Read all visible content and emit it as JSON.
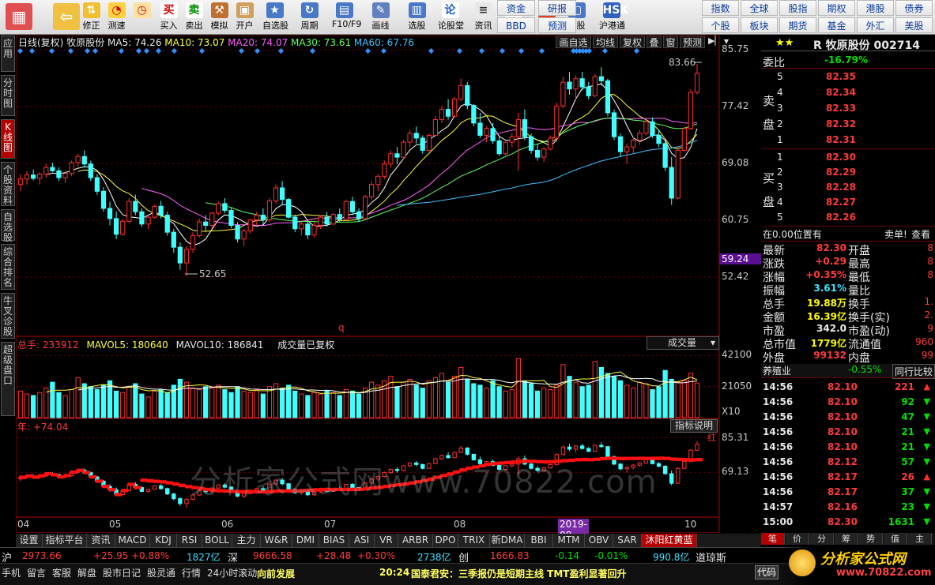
{
  "toolbar": {
    "left_buttons": [
      {
        "label": "",
        "icon": "grid-icon"
      },
      {
        "label": "",
        "icon": "back-arrow-icon"
      },
      {
        "label": "修正",
        "icon": "arrows-icon"
      },
      {
        "label": "测速",
        "icon": "speed-icon"
      },
      {
        "label": "",
        "icon": "clock-icon"
      },
      {
        "label": "买入",
        "icon": "buy-icon",
        "glyph": "买"
      },
      {
        "label": "卖出",
        "icon": "sell-icon",
        "glyph": "卖"
      },
      {
        "label": "模拟",
        "icon": "hammer-icon"
      },
      {
        "label": "开户",
        "icon": "lock-icon"
      },
      {
        "label": "自选股",
        "icon": "star-box-icon"
      },
      {
        "label": "周期",
        "icon": "cycle-icon"
      },
      {
        "label": "F10/F9",
        "icon": "f10-icon"
      },
      {
        "label": "画线",
        "icon": "pen-icon"
      },
      {
        "label": "选股",
        "icon": "chart-select-icon"
      },
      {
        "label": "论股堂",
        "icon": "forum-icon",
        "glyph": "论"
      },
      {
        "label": "资讯",
        "icon": "news-icon"
      },
      {
        "label": "数据",
        "icon": "pe-icon",
        "glyph": "PE"
      },
      {
        "label": "热点",
        "icon": "hot-icon",
        "glyph": "HOT"
      },
      {
        "label": "新股",
        "icon": "newstock-icon"
      },
      {
        "label": "沪港通",
        "icon": "hk-connect-icon",
        "glyph": "HSK"
      }
    ],
    "grid_a": [
      "资金",
      "研报",
      "BBD",
      "预测"
    ],
    "grid_b": [
      "指数",
      "全球",
      "股指",
      "期权",
      "港股",
      "债券",
      "个股",
      "板块",
      "期货",
      "基金",
      "外汇",
      "美股"
    ]
  },
  "lefttabs": [
    "应用",
    "分时图",
    "K线图",
    "个股资料",
    "自选股",
    "综合排名",
    "牛叉诊股",
    "超级盘口"
  ],
  "chart_header": {
    "title": "日线(复权)",
    "stock": "牧原股份",
    "ma5": "MA5: 74.26",
    "ma10": "MA10: 73.07",
    "ma20": "MA20: 74.07",
    "ma30": "MA30: 73.61",
    "ma60": "MA60: 67.76"
  },
  "chart_tools": [
    "画自选",
    "均线",
    "复权",
    "叠",
    "窗",
    "预测"
  ],
  "chart_data": [
    {
      "type": "candlestick",
      "title": "日线(复权)",
      "y_ticks": [
        85.75,
        77.42,
        69.08,
        60.75,
        52.42
      ],
      "current_price_tag": "59.24",
      "annotations": [
        "83.66",
        "52.65"
      ],
      "month_labels": [
        "04",
        "05",
        "06",
        "07",
        "08",
        "10"
      ],
      "highlight_date": "2019-08-28,三",
      "candles": [
        [
          66,
          67.5,
          65,
          66.8
        ],
        [
          66.8,
          68,
          66,
          67.4
        ],
        [
          67.4,
          68.2,
          66.6,
          66.9
        ],
        [
          66.9,
          67.8,
          66,
          67.5
        ],
        [
          67.5,
          69,
          67,
          68.5
        ],
        [
          68.5,
          69.2,
          67.8,
          68
        ],
        [
          68,
          68.5,
          66.5,
          67
        ],
        [
          67,
          68,
          66.2,
          67.6
        ],
        [
          67.6,
          69.5,
          67.2,
          69.2
        ],
        [
          69.2,
          70.5,
          68.6,
          70.1
        ],
        [
          70.1,
          71,
          68.5,
          69
        ],
        [
          69,
          69.5,
          66.5,
          67
        ],
        [
          67,
          67.5,
          64.5,
          65
        ],
        [
          65,
          65.6,
          62,
          62.5
        ],
        [
          62.5,
          63.5,
          60,
          61
        ],
        [
          61,
          62,
          58,
          58.7
        ],
        [
          58.7,
          61,
          58.5,
          60.6
        ],
        [
          60.6,
          64,
          60.3,
          63.5
        ],
        [
          63.5,
          64.5,
          61.5,
          62
        ],
        [
          62,
          62.5,
          59.8,
          60.2
        ],
        [
          60.2,
          61.5,
          59.5,
          61.2
        ],
        [
          61.2,
          63,
          61,
          62.8
        ],
        [
          62.8,
          63.6,
          61,
          61.5
        ],
        [
          61.5,
          62,
          58.5,
          59
        ],
        [
          59,
          59.5,
          56,
          56.8
        ],
        [
          56.8,
          57.5,
          53.5,
          54.5
        ],
        [
          54.5,
          57,
          52.6,
          56.5
        ],
        [
          56.5,
          59,
          56,
          58.5
        ],
        [
          58.5,
          61,
          58.2,
          60.5
        ],
        [
          60.5,
          61.5,
          59.2,
          60
        ],
        [
          60,
          62,
          59.6,
          61.8
        ],
        [
          61.8,
          63.5,
          61.5,
          63.2
        ],
        [
          63.2,
          64,
          61.8,
          62.2
        ],
        [
          62.2,
          62.6,
          59.6,
          60
        ],
        [
          60,
          60.5,
          57.5,
          58
        ],
        [
          58,
          59.5,
          57,
          59.2
        ],
        [
          59.2,
          61,
          58.8,
          60.8
        ],
        [
          60.8,
          62,
          60,
          61.5
        ],
        [
          61.5,
          62.5,
          60.2,
          60.8
        ],
        [
          60.8,
          64,
          60.5,
          63.6
        ],
        [
          63.6,
          66,
          63.2,
          65.5
        ],
        [
          65.5,
          66.5,
          63,
          63.8
        ],
        [
          63.8,
          64,
          61,
          61.2
        ],
        [
          61.2,
          61.6,
          59,
          59.5
        ],
        [
          59.5,
          60.5,
          58.5,
          60.2
        ],
        [
          60.2,
          60.6,
          58,
          58.6
        ],
        [
          58.6,
          60.5,
          58.2,
          60
        ],
        [
          60,
          61.5,
          59.5,
          61.2
        ],
        [
          61.2,
          62,
          59.8,
          60.2
        ],
        [
          60.2,
          61.8,
          60,
          61.6
        ],
        [
          61.6,
          62.5,
          60.5,
          60.9
        ],
        [
          60.9,
          63.8,
          60.6,
          63.5
        ],
        [
          63.5,
          64.2,
          61.5,
          62
        ],
        [
          62,
          62.5,
          60.5,
          61
        ],
        [
          61,
          64.5,
          60.8,
          64.2
        ],
        [
          64.2,
          66.5,
          63.8,
          66
        ],
        [
          66,
          67.5,
          65,
          67.2
        ],
        [
          67.2,
          69.5,
          66.8,
          69
        ],
        [
          69,
          71,
          68.5,
          70.5
        ],
        [
          70.5,
          71.5,
          69,
          70
        ],
        [
          70,
          72.5,
          69.6,
          72.2
        ],
        [
          72.2,
          74,
          71.5,
          73.5
        ],
        [
          73.5,
          74.5,
          72,
          72.8
        ],
        [
          72.8,
          73.2,
          70.5,
          71
        ],
        [
          71,
          73.5,
          70.8,
          73.2
        ],
        [
          73.2,
          76,
          73,
          75.5
        ],
        [
          75.5,
          77.5,
          75,
          77
        ],
        [
          77,
          78.5,
          75.5,
          76
        ],
        [
          76,
          78.8,
          75.8,
          78.5
        ],
        [
          78.5,
          81.5,
          78.2,
          80.5
        ],
        [
          80.5,
          81,
          77,
          77.6
        ],
        [
          77.6,
          77.8,
          74.5,
          75
        ],
        [
          75,
          76.5,
          72.8,
          73.2
        ],
        [
          73.2,
          74.5,
          72.2,
          74.2
        ],
        [
          74.2,
          75,
          72,
          72.4
        ],
        [
          72.4,
          73,
          70.2,
          70.5
        ],
        [
          70.5,
          72.5,
          70,
          72.2
        ],
        [
          72.2,
          73.5,
          71.5,
          73
        ],
        [
          73,
          76.5,
          68,
          75.5
        ],
        [
          75.5,
          77,
          72.5,
          73
        ],
        [
          73,
          73.5,
          70.5,
          71
        ],
        [
          71,
          72,
          69.5,
          70
        ],
        [
          70,
          71.5,
          69.3,
          71.2
        ],
        [
          71.2,
          73.2,
          71,
          72.8
        ],
        [
          72.8,
          78,
          72.5,
          77.5
        ],
        [
          77.5,
          81.8,
          77.2,
          81
        ],
        [
          81,
          82.5,
          79.2,
          80
        ],
        [
          80,
          82,
          78.5,
          81.5
        ],
        [
          81.5,
          82.5,
          79.8,
          80.3
        ],
        [
          80.3,
          81,
          78.5,
          79
        ],
        [
          79,
          82.2,
          78.8,
          81.8
        ],
        [
          81.8,
          83.2,
          80.5,
          81.2
        ],
        [
          81.2,
          81.5,
          76,
          76.5
        ],
        [
          76.5,
          77,
          72.5,
          73
        ],
        [
          73,
          73.5,
          70,
          70.8
        ],
        [
          70.8,
          72,
          69,
          71.5
        ],
        [
          71.5,
          73,
          70.5,
          72.5
        ],
        [
          72.5,
          74,
          71.8,
          73.5
        ],
        [
          73.5,
          75.5,
          73.2,
          75.2
        ],
        [
          75.2,
          75.8,
          72.8,
          73.2
        ],
        [
          73.2,
          74,
          71.5,
          72
        ],
        [
          72,
          72.5,
          68,
          68.5
        ],
        [
          68.5,
          70,
          63,
          64
        ],
        [
          64,
          71.5,
          63.8,
          71
        ],
        [
          71,
          74.5,
          70.8,
          74.2
        ],
        [
          74.2,
          80,
          74,
          79.5
        ],
        [
          79.5,
          83.66,
          79.2,
          82.3
        ]
      ]
    },
    {
      "type": "bar",
      "title": "总手",
      "header": {
        "total": "总手: 233912",
        "mavol5": "MAVOL5: 180640",
        "mavol10": "MAVOL10: 186841",
        "note": "成交量已复权"
      },
      "selector": "成交量",
      "y_ticks": [
        42100,
        21050
      ],
      "unit": "X10",
      "values": [
        18000,
        16000,
        15000,
        17000,
        20000,
        24000,
        17000,
        15000,
        19000,
        27000,
        23000,
        21000,
        19000,
        22000,
        25000,
        18000,
        17000,
        21000,
        23000,
        16000,
        14000,
        18000,
        19000,
        17000,
        22000,
        26000,
        24000,
        20000,
        19000,
        21000,
        20000,
        22000,
        19000,
        17000,
        21000,
        18000,
        17000,
        19000,
        16000,
        21000,
        23000,
        20000,
        22000,
        18000,
        16000,
        15000,
        17000,
        16000,
        18000,
        17000,
        15000,
        19000,
        18000,
        16000,
        20000,
        24000,
        22000,
        25000,
        28000,
        21000,
        24000,
        26000,
        22000,
        20000,
        25000,
        27000,
        30000,
        24000,
        28000,
        34000,
        26000,
        23000,
        22000,
        20000,
        25000,
        21000,
        18000,
        19000,
        40000,
        25000,
        23000,
        18000,
        20000,
        19000,
        22000,
        36000,
        28000,
        24000,
        21000,
        22000,
        38000,
        34000,
        30000,
        28000,
        25000,
        22000,
        20000,
        24000,
        23000,
        19000,
        21000,
        32000,
        26000,
        24000,
        25000,
        30000,
        23391
      ]
    },
    {
      "type": "line",
      "title": "指标",
      "header": "年: +74.04",
      "button": "指标说明",
      "y_ticks": [
        85.31,
        69.13
      ],
      "end_label": "红",
      "watermark": "分析家公式网www.70822.com"
    }
  ],
  "right": {
    "stock_title": "R 牧原股份 002714",
    "stars": "★★",
    "weibi_label": "委比",
    "weibi": "-16.79%",
    "sell_label": "卖盘",
    "buy_label": "买盘",
    "asks": [
      {
        "n": "5",
        "p": "82.35"
      },
      {
        "n": "4",
        "p": "82.34"
      },
      {
        "n": "3",
        "p": "82.33"
      },
      {
        "n": "2",
        "p": "82.32"
      },
      {
        "n": "1",
        "p": "82.31"
      }
    ],
    "bids": [
      {
        "n": "1",
        "p": "82.30"
      },
      {
        "n": "2",
        "p": "82.29"
      },
      {
        "n": "3",
        "p": "82.28"
      },
      {
        "n": "4",
        "p": "82.27"
      },
      {
        "n": "5",
        "p": "82.26"
      }
    ],
    "position_text": "在0.00位置有",
    "sell_text": "卖单!",
    "view_text": "查看",
    "stats": [
      {
        "l": "最新",
        "v": "82.30",
        "l2": "开盘",
        "v2": "8"
      },
      {
        "l": "涨跌",
        "v": "+0.29",
        "l2": "最高",
        "v2": "8"
      },
      {
        "l": "涨幅",
        "v": "+0.35%",
        "l2": "最低",
        "v2": "8"
      },
      {
        "l": "振幅",
        "v": "3.61%",
        "l2": "量比",
        "v2": ""
      },
      {
        "l": "总手",
        "v": "19.88万",
        "l2": "换手",
        "v2": "1."
      },
      {
        "l": "金额",
        "v": "16.39亿",
        "l2": "换手(实)",
        "v2": "2."
      },
      {
        "l": "市盈",
        "v": "342.0",
        "l2": "市盈(动)",
        "v2": "9"
      },
      {
        "l": "总市值",
        "v": "1779亿",
        "l2": "流通值",
        "v2": "960"
      },
      {
        "l": "外盘",
        "v": "99132",
        "l2": "内盘",
        "v2": "99"
      }
    ],
    "industry_label": "养殖业",
    "industry_change": "-0.55%",
    "industry_link": "同行比较",
    "ticks": [
      {
        "t": "14:56",
        "p": "82.10",
        "v": "221",
        "d": "up"
      },
      {
        "t": "14:56",
        "p": "82.10",
        "v": "92",
        "d": "down"
      },
      {
        "t": "14:56",
        "p": "82.10",
        "v": "47",
        "d": "down"
      },
      {
        "t": "14:56",
        "p": "82.10",
        "v": "21",
        "d": "down"
      },
      {
        "t": "14:56",
        "p": "82.10",
        "v": "21",
        "d": "down"
      },
      {
        "t": "14:56",
        "p": "82.12",
        "v": "57",
        "d": "down"
      },
      {
        "t": "14:56",
        "p": "82.17",
        "v": "26",
        "d": "up"
      },
      {
        "t": "14:56",
        "p": "82.17",
        "v": "37",
        "d": "down"
      },
      {
        "t": "14:57",
        "p": "82.16",
        "v": "23",
        "d": "down"
      },
      {
        "t": "15:00",
        "p": "82.30",
        "v": "1631",
        "d": "down"
      }
    ],
    "bottom_tabs": [
      "笔",
      "价",
      "分",
      "筹",
      "势",
      "值",
      "主"
    ]
  },
  "bottom_tabs": [
    "设置",
    "指标平台",
    "资讯",
    "MACD",
    "KDJ",
    "RSI",
    "BOLL",
    "主力",
    "W&R",
    "DMI",
    "BIAS",
    "ASI",
    "VR",
    "ARBR",
    "DPO",
    "TRIX",
    "新DMA",
    "BBI",
    "MTM",
    "OBV",
    "SAR",
    "沐阳红黄蓝"
  ],
  "status1": {
    "sh_label": "沪",
    "sh_idx": "2973.66",
    "sh_chg": "+25.95",
    "sh_pct": "+0.88%",
    "sh_amt": "1827亿",
    "sz_label": "深",
    "sz_idx": "9666.58",
    "sz_chg": "+28.48",
    "sz_pct": "+0.30%",
    "sz_amt": "2738亿",
    "cy_label": "创",
    "cy_idx": "1666.83",
    "cy_chg": "-0.14",
    "cy_pct": "-0.01%",
    "cy_amt": "990.8亿",
    "dq_label": "道琼斯"
  },
  "status2": {
    "items": [
      "手机",
      "留言",
      "客服",
      "解盘",
      "股市日记",
      "股灵通",
      "行情",
      "24小时滚动"
    ],
    "news1": "向前发展",
    "news_time": "20:24",
    "news2": "国泰君安：三季报仍是短期主线 TMT盈利显著回升",
    "code_btn": "代码"
  },
  "logo": {
    "text": "分析家公式网",
    "url": "www.70822.com"
  }
}
